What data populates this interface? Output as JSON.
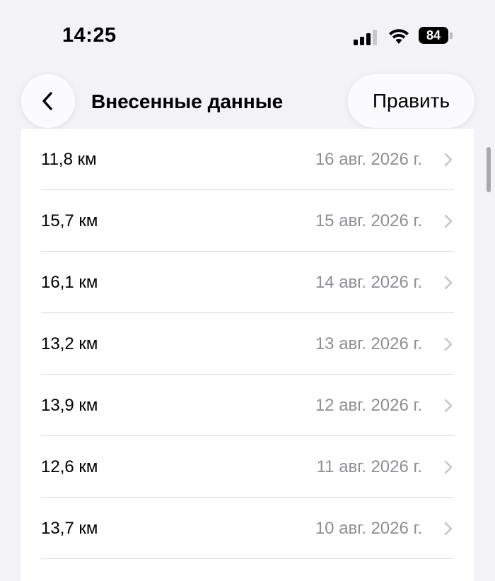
{
  "status_bar": {
    "time": "14:25",
    "battery_level": "84",
    "icons": [
      "signal-icon",
      "wifi-icon",
      "battery-icon"
    ]
  },
  "nav": {
    "back_icon": "chevron-left-icon",
    "title": "Внесенные данные",
    "edit_label": "Править"
  },
  "entries": [
    {
      "value": "11,8 км",
      "date": "16 авг. 2026 г."
    },
    {
      "value": "15,7 км",
      "date": "15 авг. 2026 г."
    },
    {
      "value": "16,1 км",
      "date": "14 авг. 2026 г."
    },
    {
      "value": "13,2 км",
      "date": "13 авг. 2026 г."
    },
    {
      "value": "13,9 км",
      "date": "12 авг. 2026 г."
    },
    {
      "value": "12,6 км",
      "date": "11 авг. 2026 г."
    },
    {
      "value": "13,7 км",
      "date": "10 авг. 2026 г."
    }
  ],
  "colors": {
    "background": "#f2f2f7",
    "secondary_text": "#8e8e93",
    "separator": "#dadadf"
  }
}
